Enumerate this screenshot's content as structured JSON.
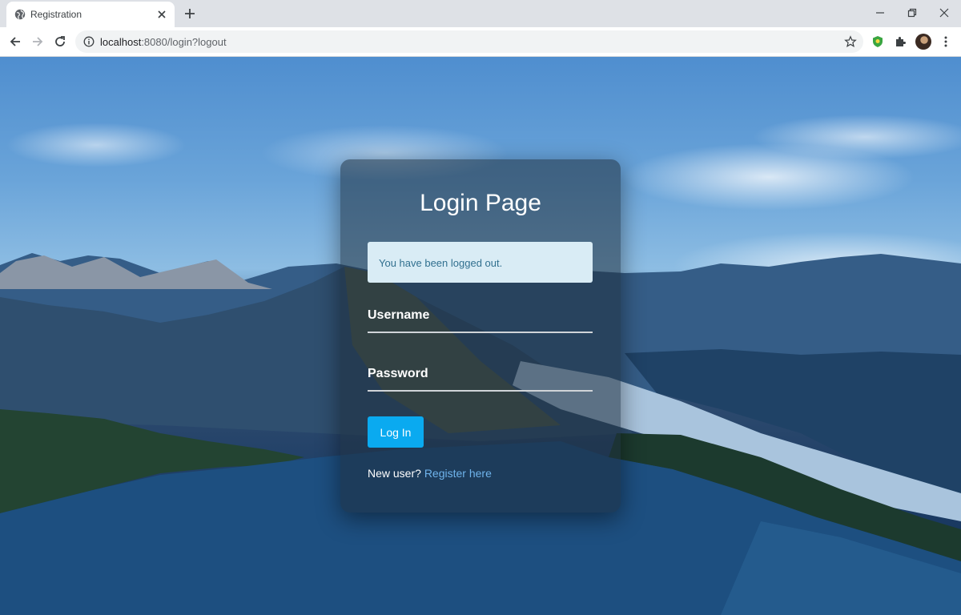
{
  "browser": {
    "tab_title": "Registration",
    "url_host": "localhost",
    "url_path": ":8080/login?logout"
  },
  "login": {
    "title": "Login Page",
    "alert": "You have been logged out.",
    "username_label": "Username",
    "username_value": "",
    "password_label": "Password",
    "password_value": "",
    "login_button": "Log In",
    "new_user_text": "New user?",
    "register_link": "Register here"
  },
  "colors": {
    "button": "#0aaaf0",
    "alert_bg": "#d9ecf5",
    "alert_text": "#31708f",
    "link": "#6fb4ec"
  }
}
